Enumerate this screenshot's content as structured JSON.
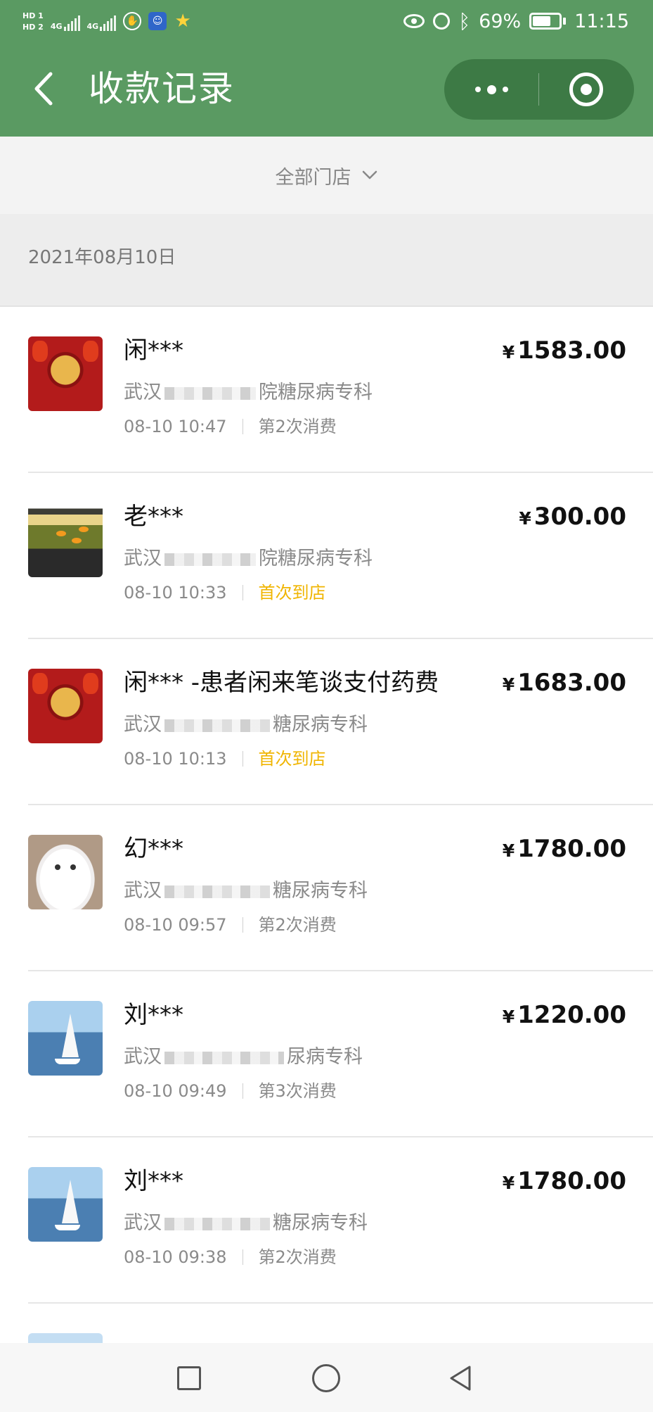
{
  "status_bar": {
    "hd1": "HD 1",
    "hd2": "HD 2",
    "net1": "4G",
    "net2": "4G",
    "battery": "69%",
    "battery_level": 0.69,
    "time": "11:15"
  },
  "header": {
    "title": "收款记录"
  },
  "filter": {
    "store_label": "全部门店"
  },
  "date_group": {
    "date": "2021年08月10日"
  },
  "records": [
    {
      "name": "闲***",
      "amount": "1583.00",
      "currency": "¥",
      "store_prefix": "武汉",
      "store_suffix": "院糖尿病专科",
      "time": "08-10 10:47",
      "visit": "第2次消费",
      "avatar": "red-seal"
    },
    {
      "name": "老***",
      "amount": "300.00",
      "currency": "¥",
      "store_prefix": "武汉",
      "store_suffix": "院糖尿病专科",
      "time": "08-10 10:33",
      "visit": "首次到店",
      "avatar": "fish-tank"
    },
    {
      "name": "闲*** -患者闲来笔谈支付药费",
      "amount": "1683.00",
      "currency": "¥",
      "store_prefix": "武汉",
      "store_suffix": "糖尿病专科",
      "time": "08-10 10:13",
      "visit": "首次到店",
      "avatar": "red-seal"
    },
    {
      "name": "幻***",
      "amount": "1780.00",
      "currency": "¥",
      "store_prefix": "武汉",
      "store_suffix": "糖尿病专科",
      "time": "08-10 09:57",
      "visit": "第2次消费",
      "avatar": "cat"
    },
    {
      "name": "刘***",
      "amount": "1220.00",
      "currency": "¥",
      "store_prefix": "武汉",
      "store_suffix": "尿病专科",
      "time": "08-10 09:49",
      "visit": "第3次消费",
      "avatar": "sailboat"
    },
    {
      "name": "刘***",
      "amount": "1780.00",
      "currency": "¥",
      "store_prefix": "武汉",
      "store_suffix": "糖尿病专科",
      "time": "08-10 09:38",
      "visit": "第2次消费",
      "avatar": "sailboat"
    }
  ],
  "colors": {
    "header_green": "#5a9a62",
    "first_visit": "#f0b500"
  }
}
